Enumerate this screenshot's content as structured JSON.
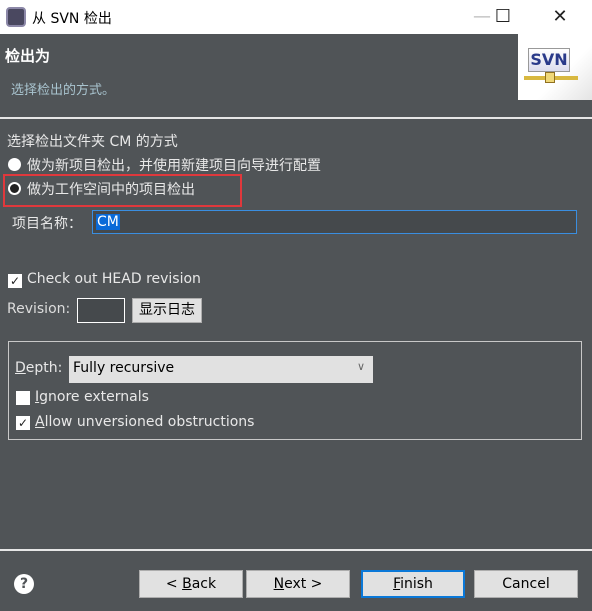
{
  "window": {
    "title": "从 SVN 检出",
    "minimize": "—",
    "maximize": "☐",
    "close": "✕"
  },
  "header": {
    "title": "检出为",
    "subtitle": "选择检出的方式。",
    "logo_text": "SVN"
  },
  "method": {
    "label": "选择检出文件夹 CM 的方式",
    "options": [
      {
        "label": "做为新项目检出，并使用新建项目向导进行配置",
        "selected": false
      },
      {
        "label": "做为工作空间中的项目检出",
        "selected": true
      }
    ]
  },
  "project": {
    "label": "项目名称：",
    "value": "CM"
  },
  "head_revision": {
    "label": "Check out HEAD revision",
    "checked": true
  },
  "revision": {
    "label": "Revision:",
    "value": "",
    "show_log": "显示日志"
  },
  "depth": {
    "label_u": "D",
    "label_rest": "epth:",
    "value": "Fully recursive"
  },
  "ignore_externals": {
    "label_u": "I",
    "label_rest": "gnore externals",
    "checked": false
  },
  "allow_unversioned": {
    "label_u": "A",
    "label_rest": "llow unversioned obstructions",
    "checked": true
  },
  "footer": {
    "help": "?",
    "back_pre": "< ",
    "back_u": "B",
    "back_rest": "ack",
    "next_u": "N",
    "next_rest": "ext >",
    "finish_u": "F",
    "finish_rest": "inish",
    "cancel": "Cancel"
  },
  "colors": {
    "background": "#505457",
    "highlight_box": "#e0383c",
    "focus": "#0a6ad8"
  }
}
